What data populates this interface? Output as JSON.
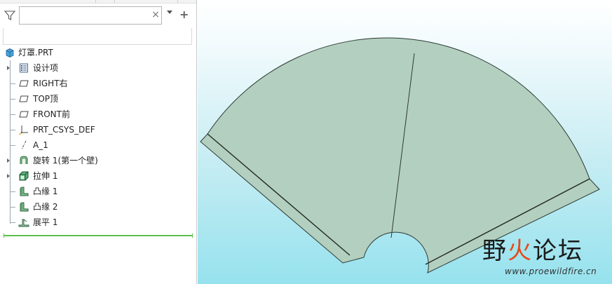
{
  "search": {
    "value": "",
    "placeholder": ""
  },
  "tree": {
    "root": {
      "label": "灯罩.PRT",
      "icon": "part-icon"
    },
    "items": [
      {
        "label": "设计项",
        "icon": "design-items-icon",
        "expandable": true
      },
      {
        "label": "RIGHT右",
        "icon": "datum-plane-icon",
        "expandable": false
      },
      {
        "label": "TOP顶",
        "icon": "datum-plane-icon",
        "expandable": false
      },
      {
        "label": "FRONT前",
        "icon": "datum-plane-icon",
        "expandable": false
      },
      {
        "label": "PRT_CSYS_DEF",
        "icon": "coordinate-system-icon",
        "expandable": false
      },
      {
        "label": "A_1",
        "icon": "datum-axis-icon",
        "expandable": false
      },
      {
        "label": "旋转 1(第一个壁)",
        "icon": "revolve-wall-icon",
        "expandable": true
      },
      {
        "label": "拉伸 1",
        "icon": "extrude-icon",
        "expandable": true
      },
      {
        "label": "凸缘 1",
        "icon": "flange-icon",
        "expandable": false
      },
      {
        "label": "凸缘 2",
        "icon": "flange-icon",
        "expandable": false
      },
      {
        "label": "展平 1",
        "icon": "flatten-icon",
        "expandable": false
      }
    ]
  },
  "colors": {
    "model_fill": "#b3cfbf",
    "model_edge": "#2c3a33",
    "insert_indicator": "#5bbf4c",
    "watermark_fire": "#e64a19"
  },
  "watermark": {
    "title_part1": "野",
    "title_fire": "火",
    "title_part2": "论坛",
    "url": "www.proewildfire.cn"
  }
}
